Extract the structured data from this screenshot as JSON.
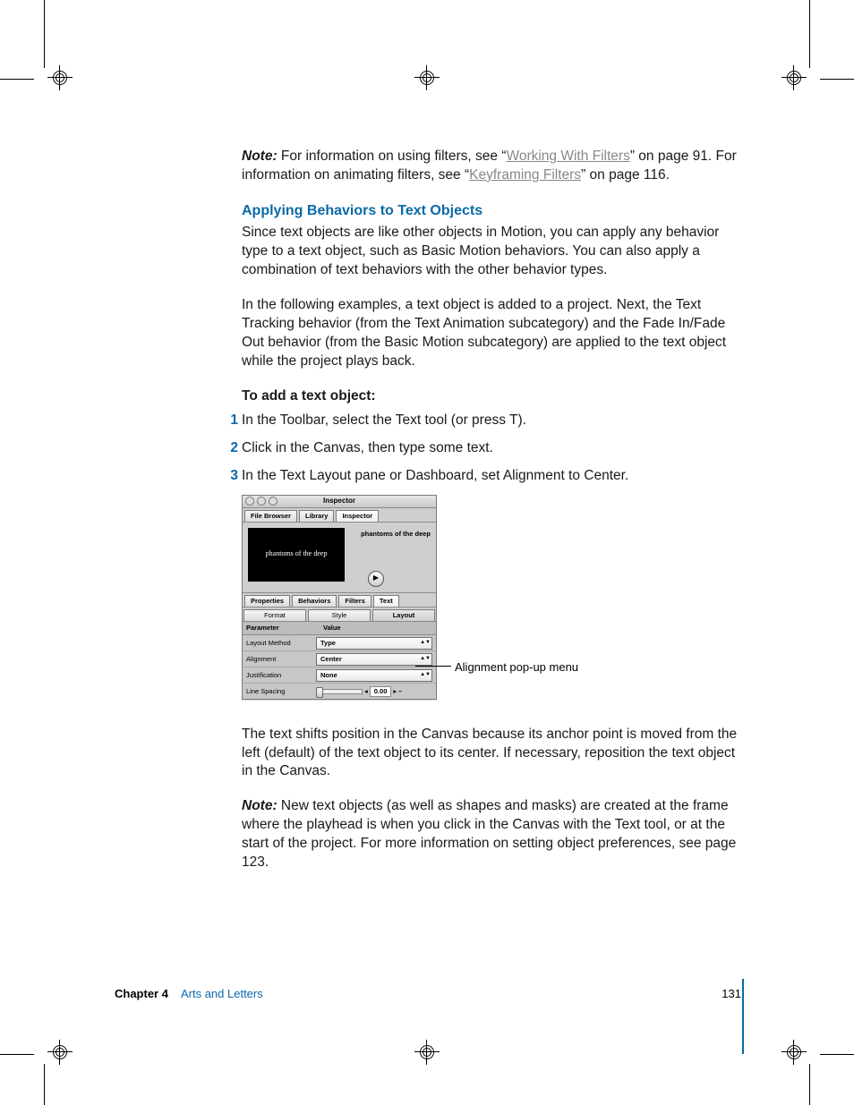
{
  "note1": {
    "label": "Note:",
    "pre": "  For information on using filters, see “",
    "link": "Working With Filters",
    "post": "” on page 91. For information on animating filters, see “",
    "link2": "Keyframing Filters",
    "post2": "” on page 116."
  },
  "subhead": "Applying Behaviors to Text Objects",
  "p1": "Since text objects are like other objects in Motion, you can apply any behavior type to a text object, such as Basic Motion behaviors. You can also apply a combination of text behaviors with the other behavior types.",
  "p2": "In the following examples, a text object is added to a project. Next, the Text Tracking behavior (from the Text Animation subcategory) and the Fade In/Fade Out behavior (from the Basic Motion subcategory) are applied to the text object while the project plays back.",
  "runin": "To add a text object:",
  "steps": [
    {
      "n": "1",
      "pre": "In the Toolbar, select the Text tool (or press ",
      "key": "T",
      "post": ")."
    },
    {
      "n": "2",
      "text": "Click in the Canvas, then type some text."
    },
    {
      "n": "3",
      "text": "In the Text Layout pane or Dashboard, set Alignment to Center."
    }
  ],
  "shot": {
    "window_title": "Inspector",
    "toptabs": [
      "File Browser",
      "Library",
      "Inspector"
    ],
    "toptabs_sel": 2,
    "preview_text": "phantoms of the deep",
    "preview_label": "phantoms of the deep",
    "midtabs": [
      "Properties",
      "Behaviors",
      "Filters",
      "Text"
    ],
    "midtabs_sel": 3,
    "subtabs": [
      "Format",
      "Style",
      "Layout"
    ],
    "subtabs_sel": 2,
    "header": [
      "Parameter",
      "Value"
    ],
    "rows": [
      {
        "k": "Layout Method",
        "v": "Type",
        "type": "pop"
      },
      {
        "k": "Alignment",
        "v": "Center",
        "type": "pop"
      },
      {
        "k": "Justification",
        "v": "None",
        "type": "pop"
      },
      {
        "k": "Line Spacing",
        "v": "0.00",
        "type": "slider"
      }
    ]
  },
  "callout": "Alignment pop-up menu",
  "p3": "The text shifts position in the Canvas because its anchor point is moved from the left (default) of the text object to its center. If necessary, reposition the text object in the Canvas.",
  "note2": {
    "label": "Note:",
    "text": "  New text objects (as well as shapes and masks) are created at the frame where the playhead is when you click in the Canvas with the Text tool, or at the start of the project. For more information on setting object preferences, see page 123."
  },
  "footer": {
    "chapter": "Chapter 4",
    "title": "Arts and Letters",
    "page": "131"
  }
}
